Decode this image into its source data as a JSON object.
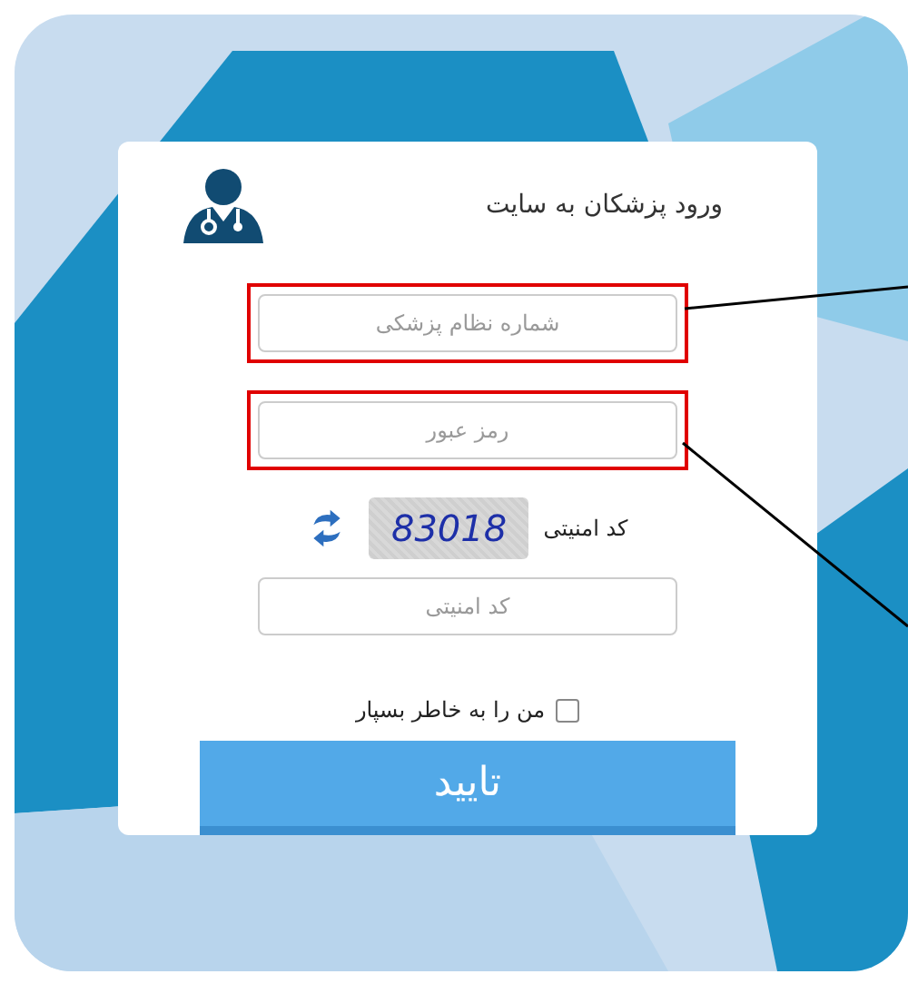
{
  "login": {
    "title": "ورود پزشکان به سایت",
    "fields": [
      {
        "placeholder": "شماره نظام پزشکی",
        "highlighted": true
      },
      {
        "placeholder": "رمز عبور",
        "highlighted": true
      }
    ],
    "captcha": {
      "label": "کد امنیتی",
      "code": "83018",
      "placeholder": "کد امنیتی"
    },
    "remember": {
      "label": "من را به خاطر بسپار",
      "checked": false
    },
    "submit": "تایید"
  }
}
